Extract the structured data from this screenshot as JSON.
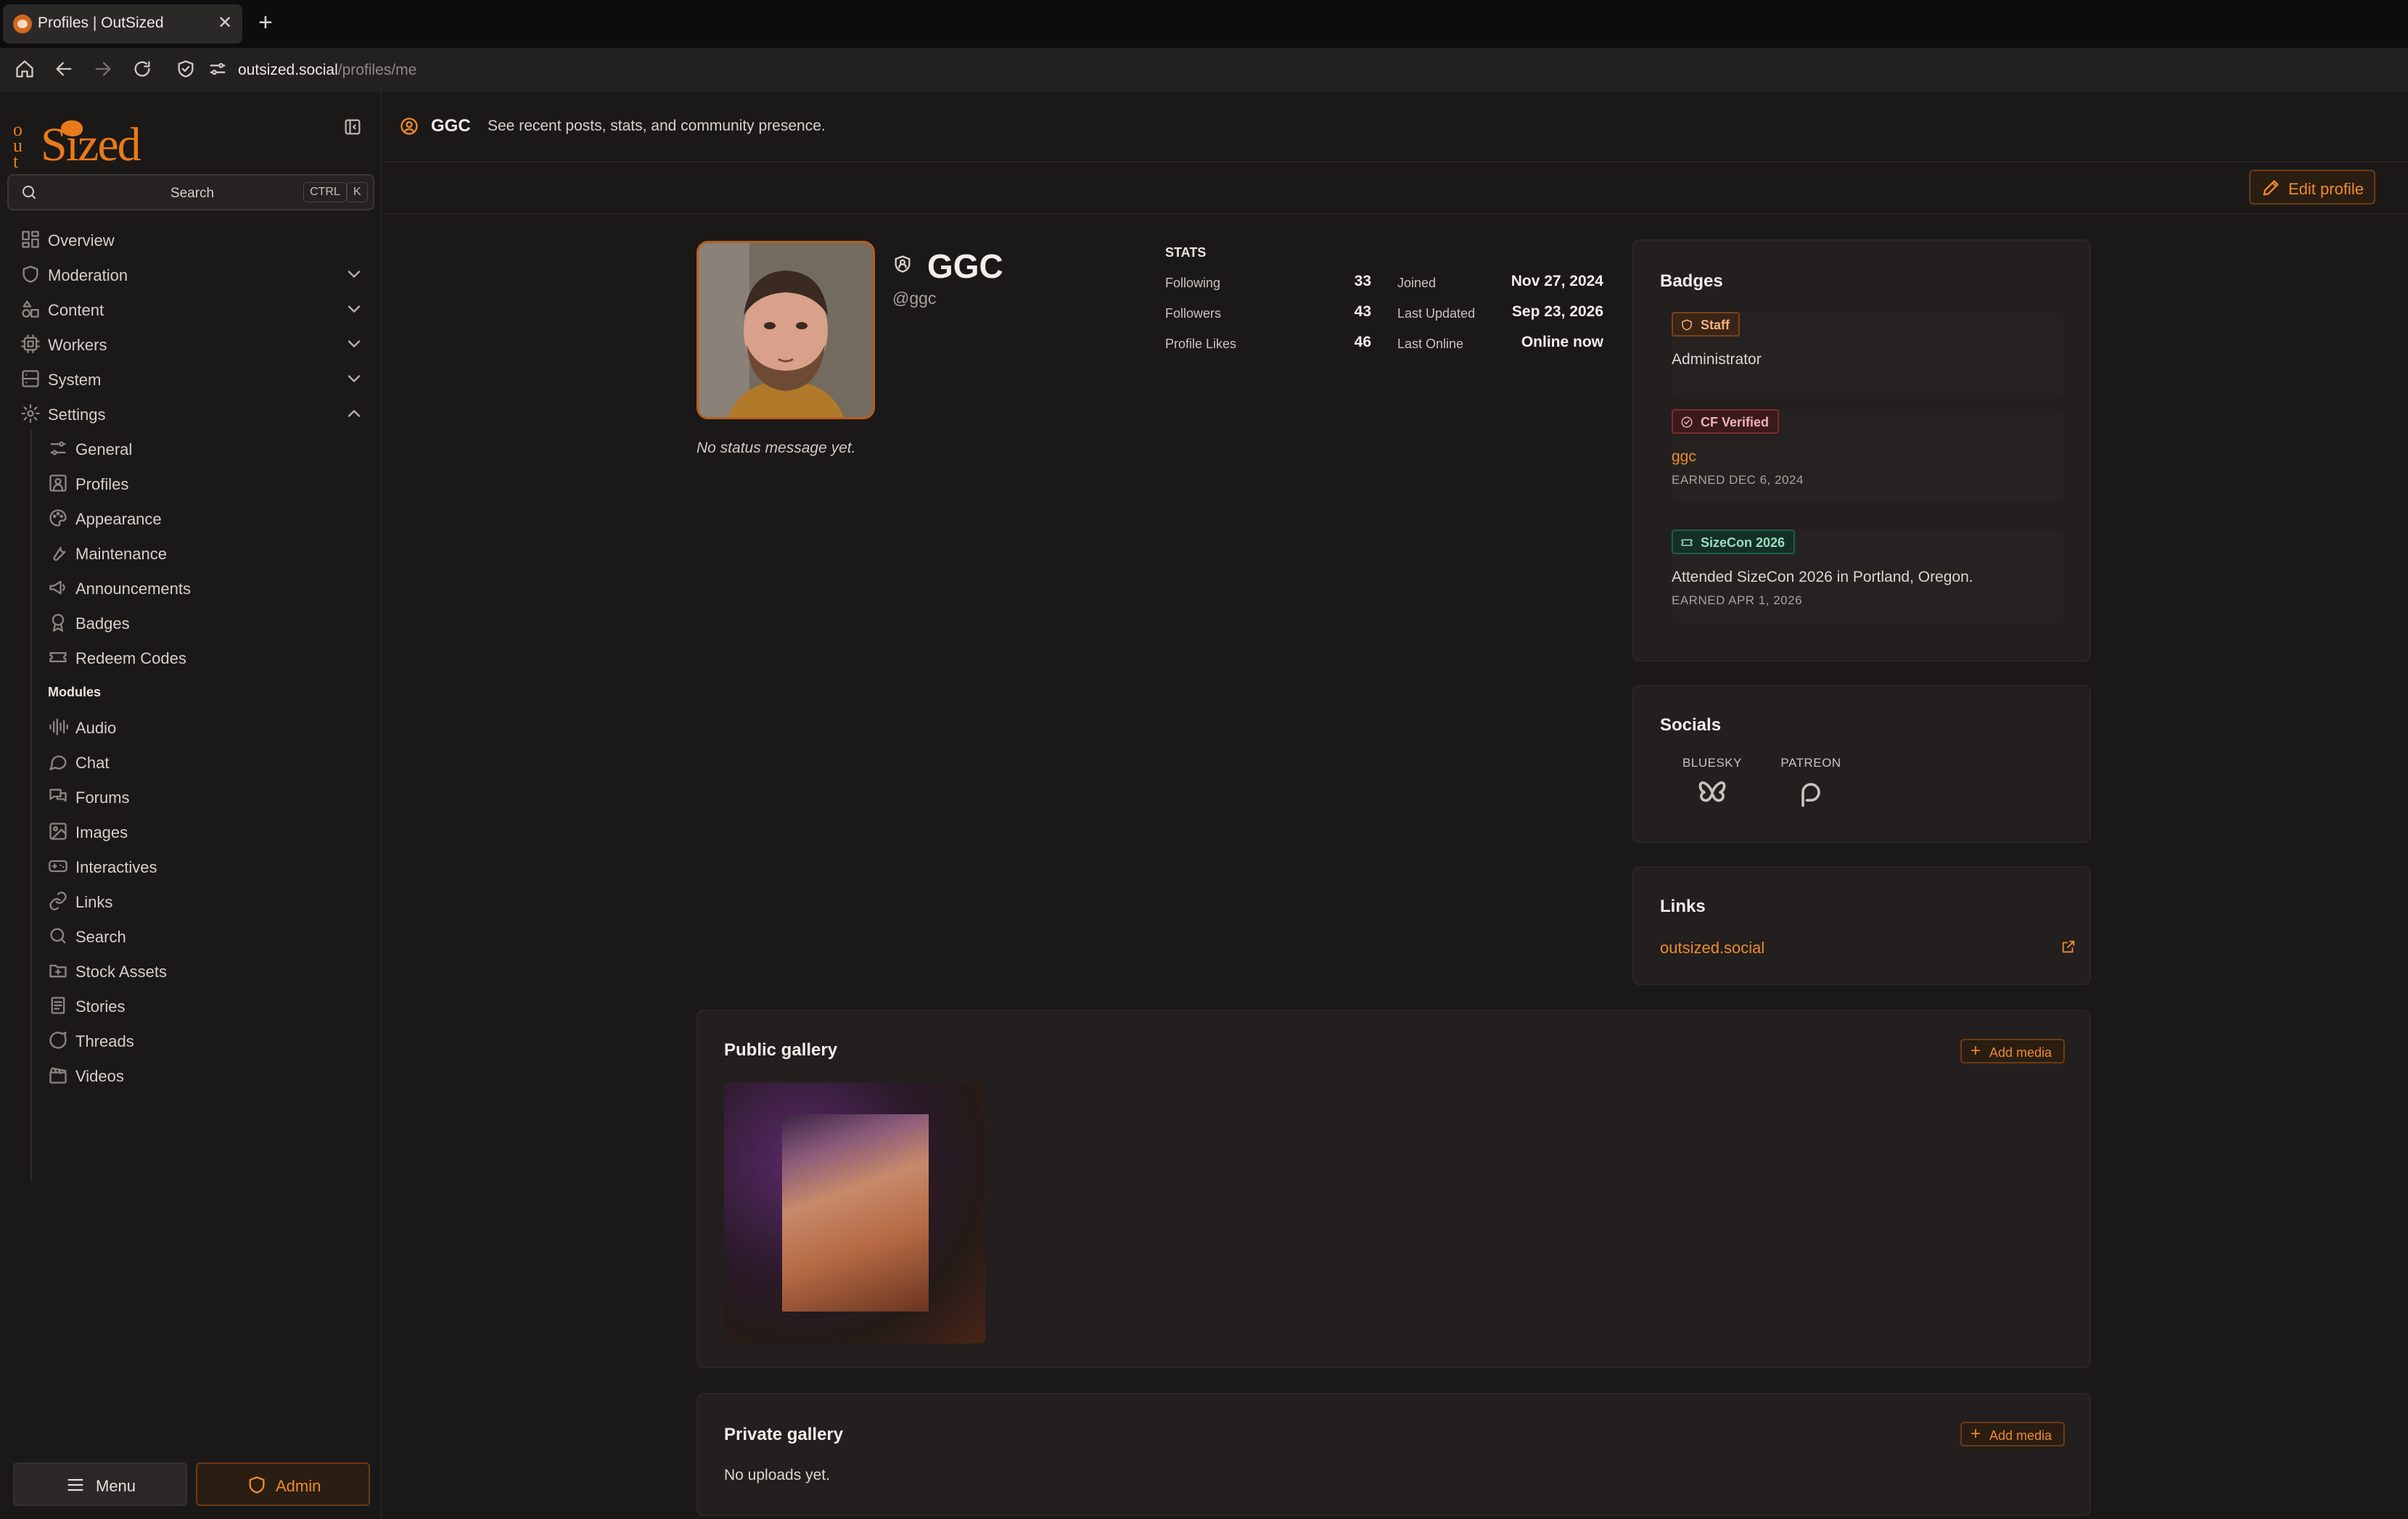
{
  "browser": {
    "tab_title": "Profiles | OutSized",
    "url_host": "outsized.social",
    "url_path": "/profiles/me"
  },
  "sidebar": {
    "logo_text": "Sized",
    "logo_prefix": "Out",
    "search_label": "Search",
    "search_key1": "CTRL",
    "search_key2": "K",
    "items": [
      {
        "label": "Overview",
        "icon": "grid-icon"
      },
      {
        "label": "Moderation",
        "icon": "shield-icon"
      },
      {
        "label": "Content",
        "icon": "shapes-icon"
      },
      {
        "label": "Workers",
        "icon": "cpu-icon"
      },
      {
        "label": "System",
        "icon": "server-icon"
      },
      {
        "label": "Settings",
        "icon": "gear-icon"
      }
    ],
    "settings_items": [
      {
        "label": "General",
        "icon": "sliders-icon"
      },
      {
        "label": "Profiles",
        "icon": "user-square-icon"
      },
      {
        "label": "Appearance",
        "icon": "palette-icon"
      },
      {
        "label": "Maintenance",
        "icon": "wrench-icon"
      },
      {
        "label": "Announcements",
        "icon": "megaphone-icon"
      },
      {
        "label": "Badges",
        "icon": "award-icon"
      },
      {
        "label": "Redeem Codes",
        "icon": "ticket-icon"
      }
    ],
    "modules_heading": "Modules",
    "module_items": [
      {
        "label": "Audio",
        "icon": "audio-lines-icon"
      },
      {
        "label": "Chat",
        "icon": "chat-bubble-icon"
      },
      {
        "label": "Forums",
        "icon": "forum-icon"
      },
      {
        "label": "Images",
        "icon": "image-icon"
      },
      {
        "label": "Interactives",
        "icon": "gamepad-icon"
      },
      {
        "label": "Links",
        "icon": "link-icon"
      },
      {
        "label": "Search",
        "icon": "search-icon"
      },
      {
        "label": "Stock Assets",
        "icon": "folder-plus-icon"
      },
      {
        "label": "Stories",
        "icon": "book-icon"
      },
      {
        "label": "Threads",
        "icon": "message-circle-icon"
      },
      {
        "label": "Videos",
        "icon": "clapperboard-icon"
      }
    ],
    "menu_label": "Menu",
    "admin_label": "Admin"
  },
  "header": {
    "title": "GGC",
    "description": "See recent posts, stats, and community presence."
  },
  "toolbar": {
    "edit_label": "Edit profile"
  },
  "profile": {
    "name": "GGC",
    "handle": "@ggc",
    "status": "No status message yet.",
    "stats_heading": "STATS",
    "stats": [
      {
        "label": "Following",
        "value": "33",
        "dlabel": "Joined",
        "dvalue": "Nov 27, 2024"
      },
      {
        "label": "Followers",
        "value": "43",
        "dlabel": "Last Updated",
        "dvalue": "Sep 23, 2026"
      },
      {
        "label": "Profile Likes",
        "value": "46",
        "dlabel": "Last Online",
        "dvalue": "Online now"
      }
    ]
  },
  "badges": {
    "title": "Badges",
    "items": [
      {
        "name": "Staff",
        "desc": "Administrator",
        "earned": ""
      },
      {
        "name": "CF Verified",
        "desc": "ggc",
        "earned": "EARNED DEC 6, 2024"
      },
      {
        "name": "SizeCon 2026",
        "desc": "Attended SizeCon 2026 in Portland, Oregon.",
        "earned": "EARNED APR 1, 2026"
      }
    ]
  },
  "socials": {
    "title": "Socials",
    "items": [
      {
        "label": "BLUESKY",
        "icon": "butterfly-icon"
      },
      {
        "label": "PATREON",
        "icon": "patreon-icon"
      }
    ]
  },
  "links": {
    "title": "Links",
    "items": [
      {
        "label": "outsized.social"
      }
    ]
  },
  "public_gallery": {
    "title": "Public gallery",
    "add_label": "Add media"
  },
  "private_gallery": {
    "title": "Private gallery",
    "add_label": "Add media",
    "empty": "No uploads yet."
  },
  "colors": {
    "accent": "#ee8a2c",
    "background": "#1b1918",
    "card": "#221f1e"
  }
}
